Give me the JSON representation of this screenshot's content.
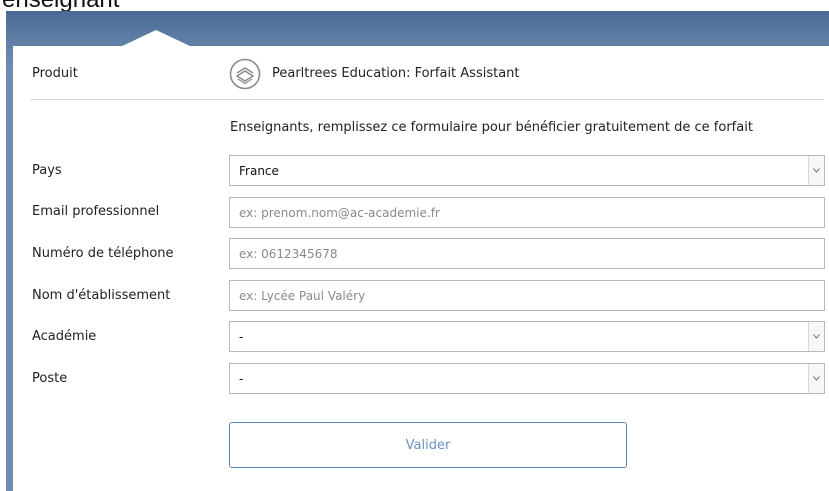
{
  "page": {
    "heading": "enseignant"
  },
  "product": {
    "label": "Produit",
    "name": "Pearltrees Education: Forfait Assistant",
    "logo_icon": "pearltrees-logo-icon"
  },
  "intro_text": "Enseignants, remplissez ce formulaire pour bénéficier gratuitement de ce forfait",
  "fields": {
    "country": {
      "label": "Pays",
      "value": "France"
    },
    "email": {
      "label": "Email professionnel",
      "placeholder": "ex: prenom.nom@ac-academie.fr"
    },
    "phone": {
      "label": "Numéro de téléphone",
      "placeholder": "ex: 0612345678"
    },
    "school": {
      "label": "Nom d'établissement",
      "placeholder": "ex: Lycée Paul Valéry"
    },
    "academy": {
      "label": "Académie",
      "value": "-"
    },
    "position": {
      "label": "Poste",
      "value": "-"
    }
  },
  "submit_label": "Valider",
  "colors": {
    "frame": "#6f8db1",
    "accent": "#5d86b6",
    "button_text": "#6d90bf"
  }
}
